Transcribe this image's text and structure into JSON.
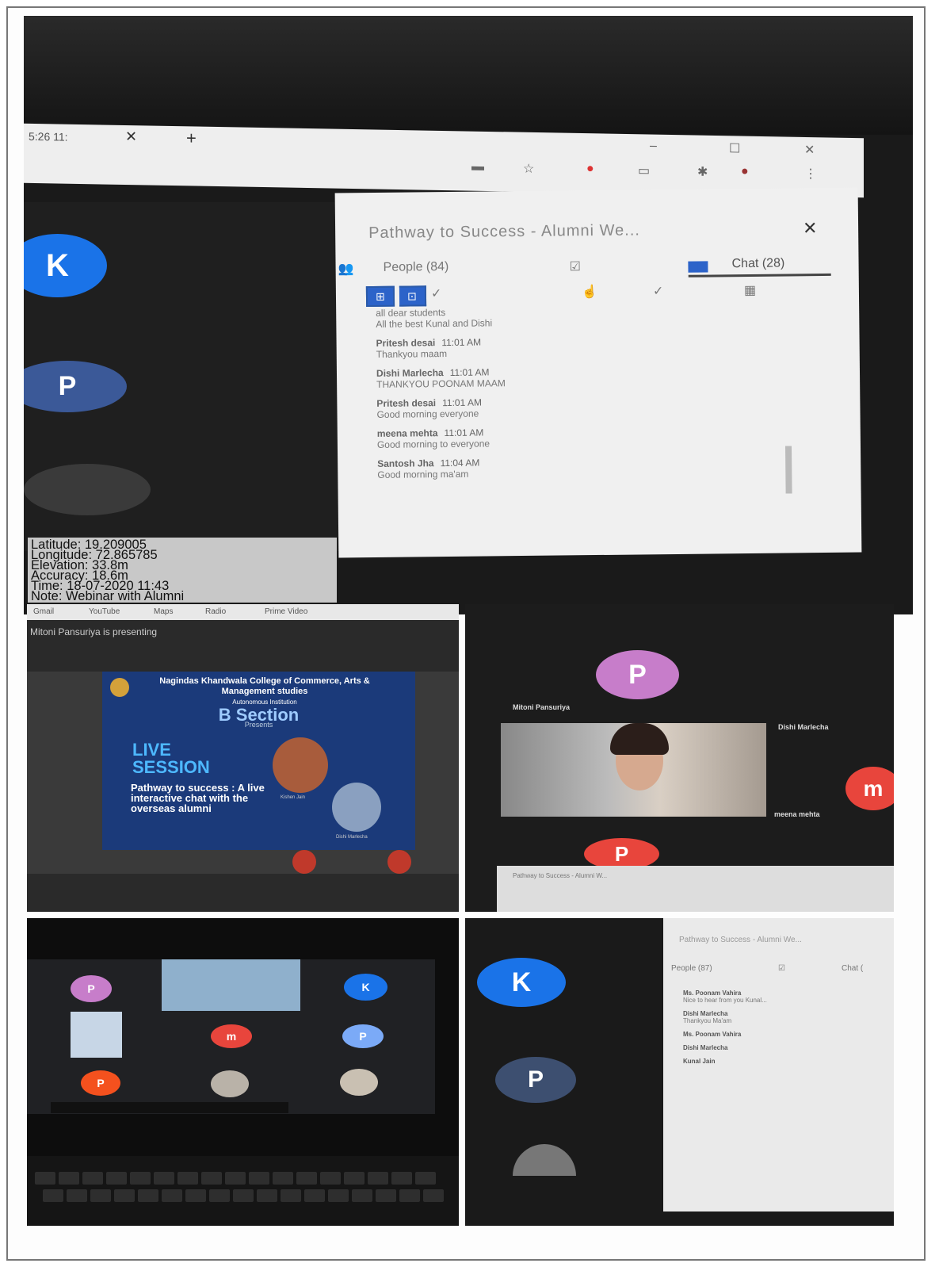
{
  "top": {
    "tab_fragment": "5:26 11:",
    "window_controls": [
      "–",
      "☐",
      "✕"
    ],
    "meeting_title": "Pathway to Success - Alumni We...",
    "people_tab": "People (84)",
    "chat_tab": "Chat (28)",
    "avatars": [
      {
        "letter": "K",
        "color": "#1a73e8"
      },
      {
        "letter": "P",
        "color": "#3b5998"
      }
    ],
    "messages": [
      {
        "sender": "",
        "time": "",
        "text": "all dear students"
      },
      {
        "sender": "",
        "time": "",
        "text": "All the best Kunal and Dishi"
      },
      {
        "sender": "Pritesh desai",
        "time": "11:01 AM",
        "text": "Thankyou maam"
      },
      {
        "sender": "Dishi Marlecha",
        "time": "11:01 AM",
        "text": "THANKYOU POONAM MAAM"
      },
      {
        "sender": "Pritesh desai",
        "time": "11:01 AM",
        "text": "Good morning everyone"
      },
      {
        "sender": "meena mehta",
        "time": "11:01 AM",
        "text": "Good morning to everyone"
      },
      {
        "sender": "Santosh Jha",
        "time": "11:04 AM",
        "text": "Good morning ma'am"
      }
    ],
    "geotag": [
      "Latitude: 19.209005",
      "Longitude: 72.865785",
      "Elevation: 33.8m",
      "Accuracy: 18.6m",
      "Time: 18-07-2020 11:43",
      "Note: Webinar with Alumni"
    ]
  },
  "mid_left": {
    "bookmarks": [
      "Gmail",
      "YouTube",
      "Maps",
      "Radio",
      "Prime Video"
    ],
    "presenting": "Mitoni Pansuriya is presenting",
    "college": "Nagindas Khandwala College of Commerce, Arts & Management studies",
    "autonomous": "Autonomous Institution",
    "section": "B Section",
    "presents": "Presents",
    "live": "LIVE",
    "session": "SESSION",
    "tagline": "Pathway to success : A live interactive chat with the overseas alumni",
    "speaker1": "Kishen Jain",
    "speaker2": "Dishi Marlecha"
  },
  "mid_right": {
    "avatar_top": {
      "letter": "P",
      "color": "#c77dca"
    },
    "avatar_right": {
      "letter": "m",
      "color": "#e8453c"
    },
    "avatar_bottom": {
      "letter": "P",
      "color": "#e8453c"
    },
    "presenter_tag": "Mitoni Pansuriya",
    "tag_dishi": "Dishi Marlecha",
    "tag_meena": "meena mehta",
    "bottom_chat_title": "Pathway to Success - Alumni W..."
  },
  "bottom_left": {
    "tiles": [
      {
        "letter": "P",
        "color": "#c77dca"
      },
      {
        "letter": "K",
        "color": "#1a73e8"
      },
      {
        "letter": "m",
        "color": "#e8453c"
      },
      {
        "letter": "P",
        "color": "#7baaf7"
      },
      {
        "letter": "P",
        "color": "#f4511e"
      }
    ]
  },
  "bottom_right": {
    "avatars": [
      {
        "letter": "K",
        "color": "#1a73e8"
      },
      {
        "letter": "P",
        "color": "#3d4f70"
      }
    ],
    "title": "Pathway to Success - Alumni We...",
    "people_tab": "People (87)",
    "chat_tab": "Chat (",
    "messages": [
      {
        "sender": "Ms. Poonam Vahira",
        "text": "Nice to hear from you Kunal..."
      },
      {
        "sender": "Dishi Marlecha",
        "text": "Thankyou Ma'am"
      },
      {
        "sender": "Ms. Poonam Vahira",
        "text": ""
      },
      {
        "sender": "Dishi Marlecha",
        "text": ""
      },
      {
        "sender": "Kunal Jain",
        "text": ""
      }
    ]
  }
}
